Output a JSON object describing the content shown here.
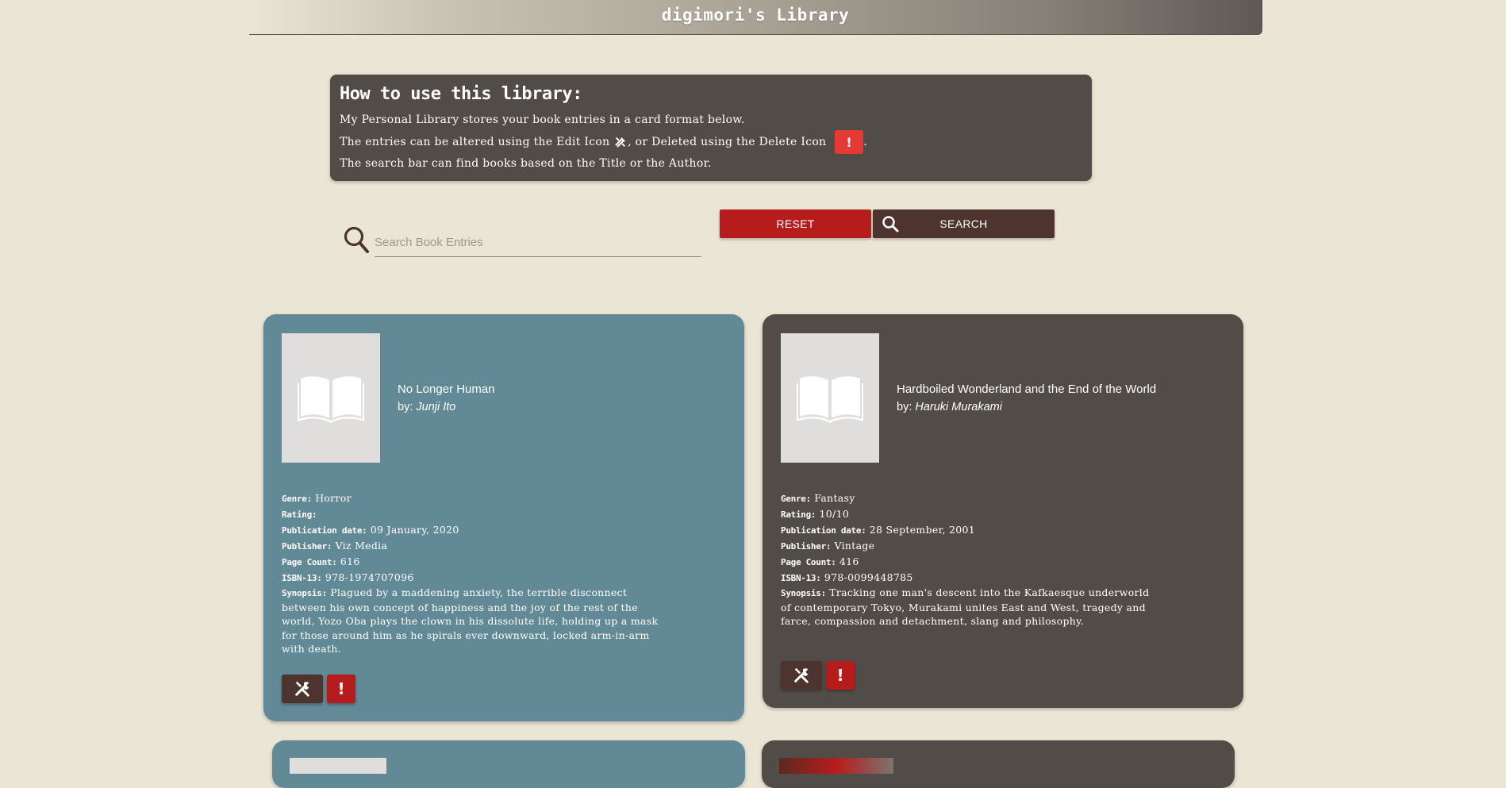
{
  "header": {
    "title": "digimori's Library"
  },
  "howto": {
    "heading": "How to use this library:",
    "line1": "My Personal Library stores your book entries in a card format below.",
    "line2_a": "The entries can be altered using the Edit Icon ",
    "line2_b": ", or Deleted using the Delete Icon ",
    "line2_c": ".",
    "delete_glyph": "!",
    "line3": "The search bar can find books based on the Title or the Author."
  },
  "search": {
    "placeholder": "Search Book Entries",
    "value": ""
  },
  "buttons": {
    "reset": "RESET",
    "search": "SEARCH"
  },
  "books": [
    {
      "title": "No Longer Human",
      "by": "by: ",
      "author": "Junji Ito",
      "labels": {
        "genre": "Genre:",
        "rating": "Rating:",
        "pubdate": "Publication date:",
        "publisher": "Publisher:",
        "pages": "Page Count:",
        "isbn": "ISBN-13:",
        "synopsis": "Synopsis:"
      },
      "genre": "Horror",
      "rating": "",
      "pubdate": "09 January, 2020",
      "publisher": "Viz Media",
      "pages": "616",
      "isbn": "978-1974707096",
      "synopsis": "Plagued by a maddening anxiety, the terrible disconnect between his own concept of happiness and the joy of the rest of the world, Yozo Oba plays the clown in his dissolute life, holding up a mask for those around him as he spirals ever downward, locked arm-in-arm with death.",
      "color": "#628996"
    },
    {
      "title": "Hardboiled Wonderland and the End of the World",
      "by": "by: ",
      "author": "Haruki Murakami",
      "labels": {
        "genre": "Genre:",
        "rating": "Rating:",
        "pubdate": "Publication date:",
        "publisher": "Publisher:",
        "pages": "Page Count:",
        "isbn": "ISBN-13:",
        "synopsis": "Synopsis:"
      },
      "genre": "Fantasy",
      "rating": "10/10",
      "pubdate": "28 September, 2001",
      "publisher": "Vintage",
      "pages": "416",
      "isbn": "978-0099448785",
      "synopsis": "Tracking one man's descent into the Kafkaesque underworld of contemporary Tokyo, Murakami unites East and West, tragedy and farce, compassion and detachment, slang and philosophy.",
      "color": "#524c48"
    }
  ],
  "actions": {
    "delete_glyph": "!"
  },
  "icons": {
    "search": "search-icon",
    "edit": "wrench-screwdriver-icon",
    "delete": "exclamation-icon",
    "cover": "open-book-icon"
  },
  "colors": {
    "background": "#ebe5d6",
    "panel": "#524c48",
    "teal_card": "#628996",
    "reset": "#b71c1c",
    "search_button": "#4e342e",
    "delete": "#b71c1c"
  }
}
